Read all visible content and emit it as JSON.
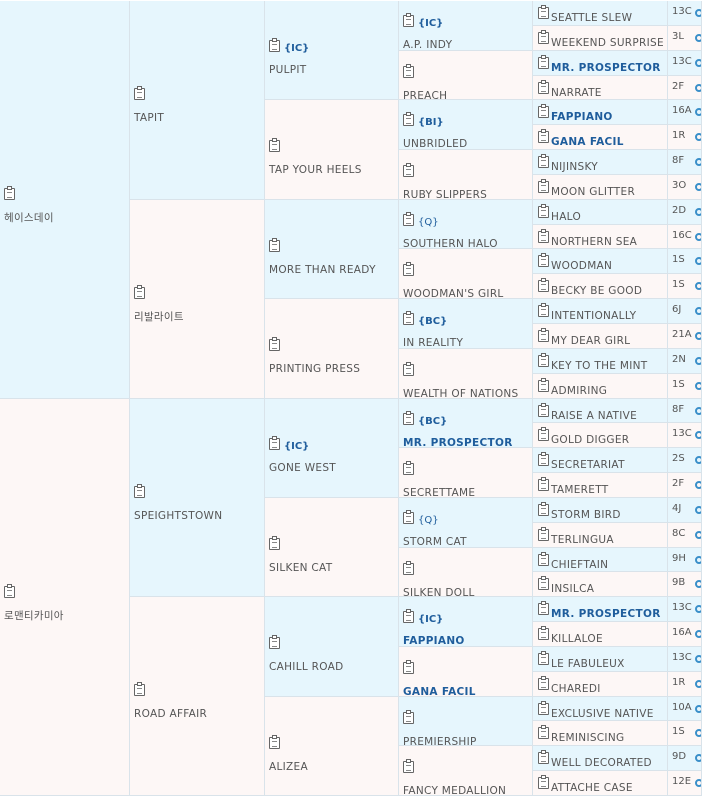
{
  "g1": [
    {
      "name": "헤이스데이"
    },
    {
      "name": "로맨티카미아"
    }
  ],
  "g2": [
    {
      "name": "TAPIT"
    },
    {
      "name": "리발라이트"
    },
    {
      "name": "SPEIGHTSTOWN"
    },
    {
      "name": "ROAD AFFAIR"
    }
  ],
  "g3": [
    {
      "tag": "{IC}",
      "name": "PULPIT"
    },
    {
      "tag": "",
      "name": "TAP YOUR HEELS"
    },
    {
      "tag": "",
      "name": "MORE THAN READY"
    },
    {
      "tag": "",
      "name": "PRINTING PRESS"
    },
    {
      "tag": "{IC}",
      "name": "GONE WEST"
    },
    {
      "tag": "",
      "name": "SILKEN CAT"
    },
    {
      "tag": "",
      "name": "CAHILL ROAD"
    },
    {
      "tag": "",
      "name": "ALIZEA"
    }
  ],
  "g4": [
    {
      "tag": "{IC}",
      "name": "A.P. INDY",
      "bold": false
    },
    {
      "tag": "",
      "name": "PREACH",
      "bold": false
    },
    {
      "tag": "{BI}",
      "name": "UNBRIDLED",
      "bold": false
    },
    {
      "tag": "",
      "name": "RUBY SLIPPERS",
      "bold": false
    },
    {
      "tag": "{Q}",
      "name": "SOUTHERN HALO",
      "bold": false
    },
    {
      "tag": "",
      "name": "WOODMAN'S GIRL",
      "bold": false
    },
    {
      "tag": "{BC}",
      "name": "IN REALITY",
      "bold": false
    },
    {
      "tag": "",
      "name": "WEALTH OF NATIONS",
      "bold": false
    },
    {
      "tag": "{BC}",
      "name": "MR. PROSPECTOR",
      "bold": true
    },
    {
      "tag": "",
      "name": "SECRETTAME",
      "bold": false
    },
    {
      "tag": "{Q}",
      "name": "STORM CAT",
      "bold": false
    },
    {
      "tag": "",
      "name": "SILKEN DOLL",
      "bold": false
    },
    {
      "tag": "{IC}",
      "name": "FAPPIANO",
      "bold": true
    },
    {
      "tag": "",
      "name": "GANA FACIL",
      "bold": true
    },
    {
      "tag": "",
      "name": "PREMIERSHIP",
      "bold": false
    },
    {
      "tag": "",
      "name": "FANCY MEDALLION",
      "bold": false
    }
  ],
  "g5": [
    {
      "name": "SEATTLE SLEW",
      "code": "13C",
      "bold": false
    },
    {
      "name": "WEEKEND SURPRISE",
      "code": "3L",
      "bold": false
    },
    {
      "name": "MR. PROSPECTOR",
      "code": "13C",
      "bold": true
    },
    {
      "name": "NARRATE",
      "code": "2F",
      "bold": false
    },
    {
      "name": "FAPPIANO",
      "code": "16A",
      "bold": true
    },
    {
      "name": "GANA FACIL",
      "code": "1R",
      "bold": true
    },
    {
      "name": "NIJINSKY",
      "code": "8F",
      "bold": false
    },
    {
      "name": "MOON GLITTER",
      "code": "3O",
      "bold": false
    },
    {
      "name": "HALO",
      "code": "2D",
      "bold": false
    },
    {
      "name": "NORTHERN SEA",
      "code": "16C",
      "bold": false
    },
    {
      "name": "WOODMAN",
      "code": "1S",
      "bold": false
    },
    {
      "name": "BECKY BE GOOD",
      "code": "1S",
      "bold": false
    },
    {
      "name": "INTENTIONALLY",
      "code": "6J",
      "bold": false
    },
    {
      "name": "MY DEAR GIRL",
      "code": "21A",
      "bold": false
    },
    {
      "name": "KEY TO THE MINT",
      "code": "2N",
      "bold": false
    },
    {
      "name": "ADMIRING",
      "code": "1S",
      "bold": false
    },
    {
      "name": "RAISE A NATIVE",
      "code": "8F",
      "bold": false
    },
    {
      "name": "GOLD DIGGER",
      "code": "13C",
      "bold": false
    },
    {
      "name": "SECRETARIAT",
      "code": "2S",
      "bold": false
    },
    {
      "name": "TAMERETT",
      "code": "2F",
      "bold": false
    },
    {
      "name": "STORM BIRD",
      "code": "4J",
      "bold": false
    },
    {
      "name": "TERLINGUA",
      "code": "8C",
      "bold": false
    },
    {
      "name": "CHIEFTAIN",
      "code": "9H",
      "bold": false
    },
    {
      "name": "INSILCA",
      "code": "9B",
      "bold": false
    },
    {
      "name": "MR. PROSPECTOR",
      "code": "13C",
      "bold": true
    },
    {
      "name": "KILLALOE",
      "code": "16A",
      "bold": false
    },
    {
      "name": "LE FABULEUX",
      "code": "13C",
      "bold": false
    },
    {
      "name": "CHAREDI",
      "code": "1R",
      "bold": false
    },
    {
      "name": "EXCLUSIVE NATIVE",
      "code": "10A",
      "bold": false
    },
    {
      "name": "REMINISCING",
      "code": "1S",
      "bold": false
    },
    {
      "name": "WELL DECORATED",
      "code": "9D",
      "bold": false
    },
    {
      "name": "ATTACHE CASE",
      "code": "12E",
      "bold": false
    }
  ]
}
